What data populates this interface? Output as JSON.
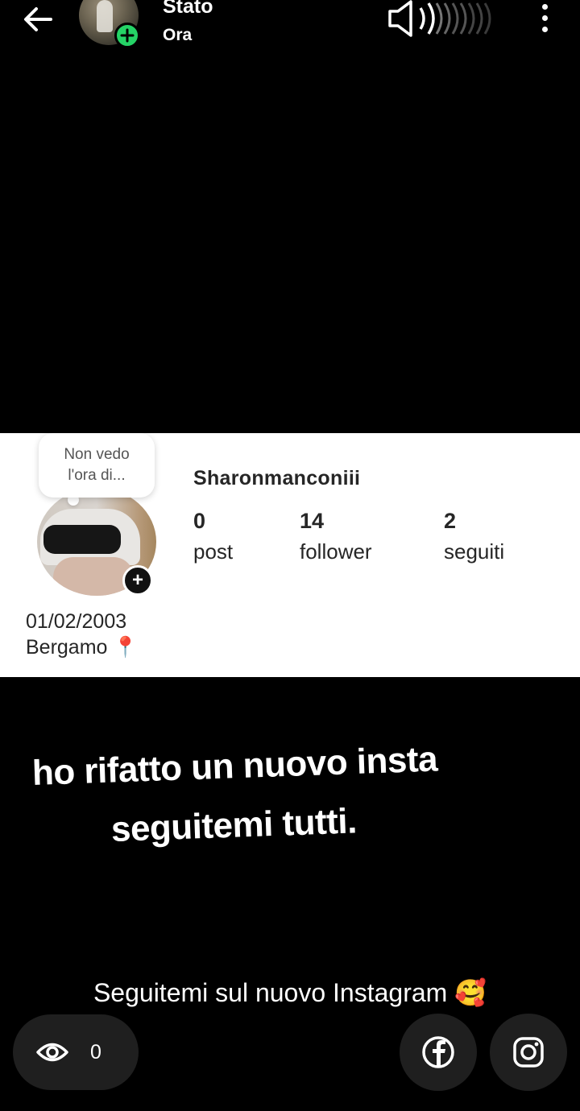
{
  "header": {
    "title": "Stato",
    "time": "Ora"
  },
  "profile": {
    "bubble_line1": "Non vedo",
    "bubble_line2": "l'ora di...",
    "username": "Sharonmanconiii",
    "stats": [
      {
        "value": "0",
        "label": "post"
      },
      {
        "value": "14",
        "label": "follower"
      },
      {
        "value": "2",
        "label": "seguiti"
      }
    ],
    "birthdate": "01/02/2003",
    "location": "Bergamo 📍"
  },
  "caption": {
    "line1": "ho rifatto un nuovo insta",
    "line2": "seguitemi tutti.",
    "subtitle": "Seguitemi sul nuovo Instagram 🥰"
  },
  "footer": {
    "views_count": "0"
  },
  "icons": {
    "back": "arrow-left-icon",
    "sound": "speaker-icon",
    "more": "more-vertical-icon",
    "views": "eye-icon",
    "facebook": "facebook-icon",
    "instagram": "instagram-icon"
  },
  "colors": {
    "background": "#000000",
    "accent_green": "#25d366",
    "card": "#ffffff",
    "button_bg": "#1f1f1f"
  }
}
